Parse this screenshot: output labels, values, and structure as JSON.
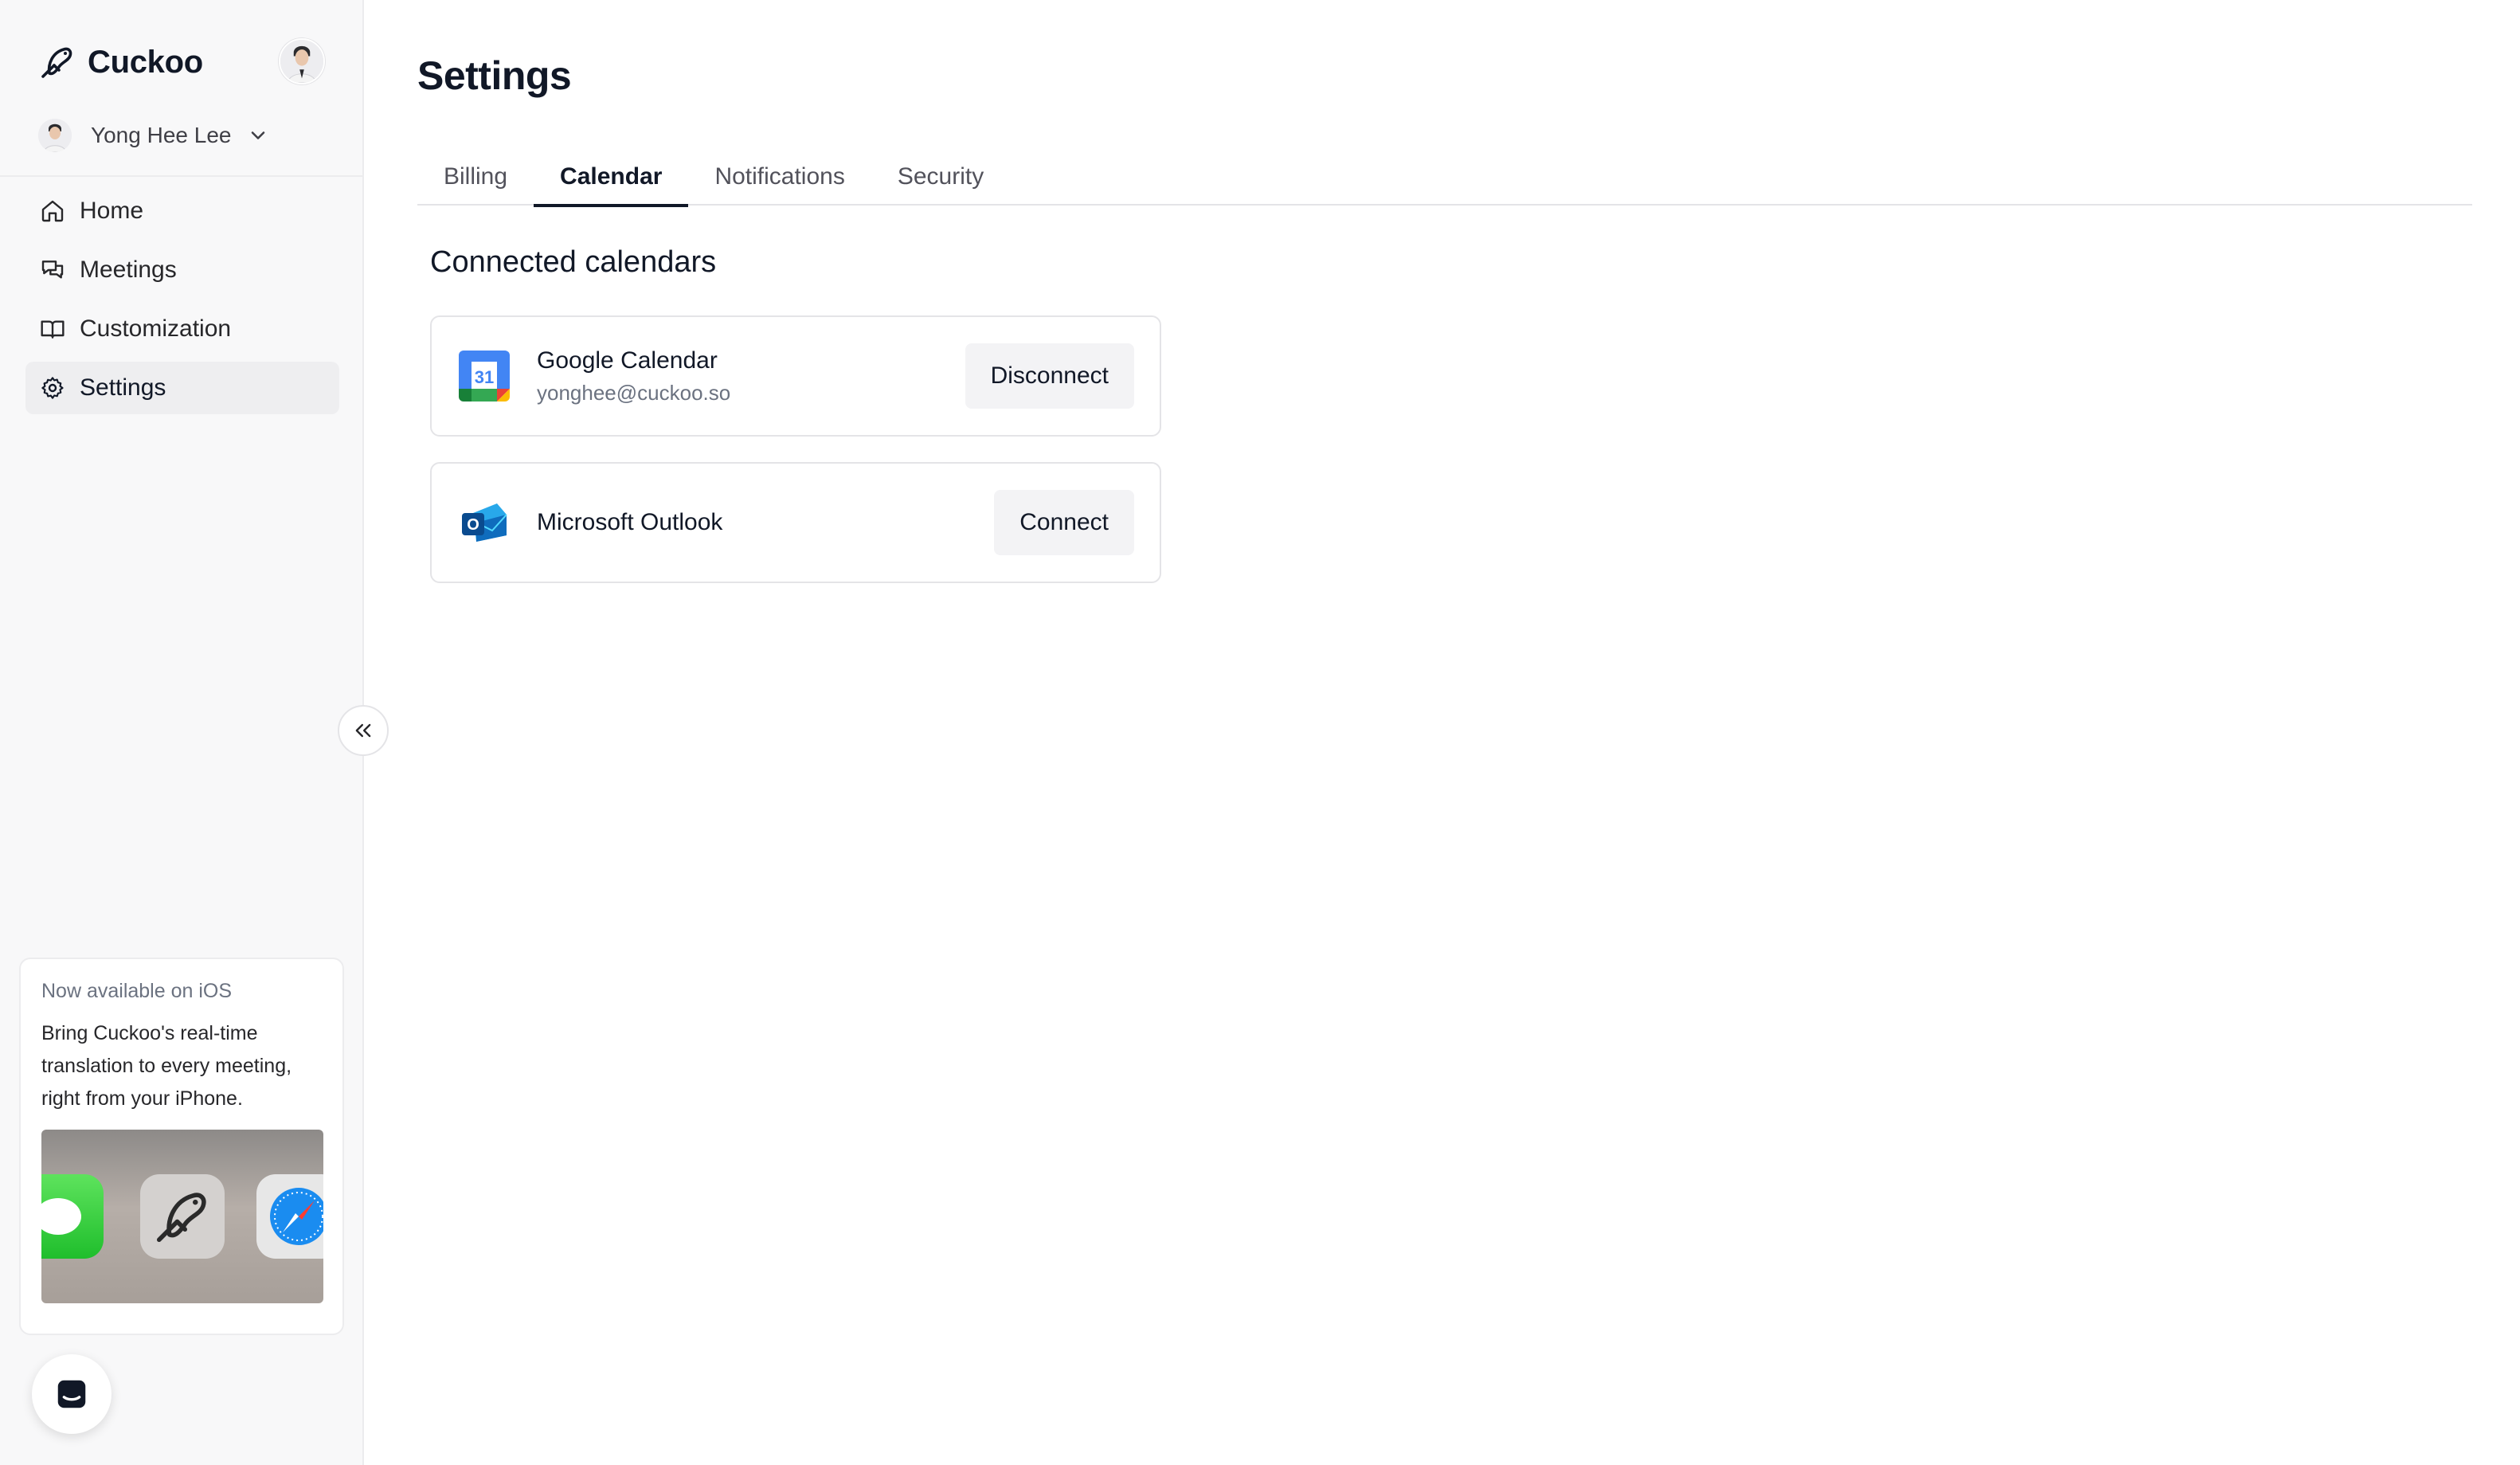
{
  "brand": {
    "name": "Cuckoo"
  },
  "user": {
    "name": "Yong Hee Lee"
  },
  "nav": {
    "items": [
      {
        "label": "Home",
        "icon": "home-icon"
      },
      {
        "label": "Meetings",
        "icon": "chat-bubbles-icon"
      },
      {
        "label": "Customization",
        "icon": "book-icon"
      },
      {
        "label": "Settings",
        "icon": "gear-icon",
        "active": true
      }
    ]
  },
  "promo": {
    "kicker": "Now available on iOS",
    "body": "Bring Cuckoo's real-time translation to every meeting, right from your iPhone."
  },
  "page": {
    "title": "Settings"
  },
  "tabs": [
    {
      "label": "Billing"
    },
    {
      "label": "Calendar",
      "active": true
    },
    {
      "label": "Notifications"
    },
    {
      "label": "Security"
    }
  ],
  "calendars": {
    "title": "Connected calendars",
    "items": [
      {
        "name": "Google Calendar",
        "email": "yonghee@cuckoo.so",
        "action": "Disconnect",
        "logo_text": "31"
      },
      {
        "name": "Microsoft Outlook",
        "action": "Connect",
        "logo_text": "O"
      }
    ]
  },
  "colors": {
    "sidebar_bg": "#f8f8f9",
    "active_nav_bg": "#eeeef0",
    "button_bg": "#f3f3f5",
    "text_primary": "#111827",
    "google_blue": "#4285f4",
    "outlook_blue": "#0f6cbd"
  }
}
